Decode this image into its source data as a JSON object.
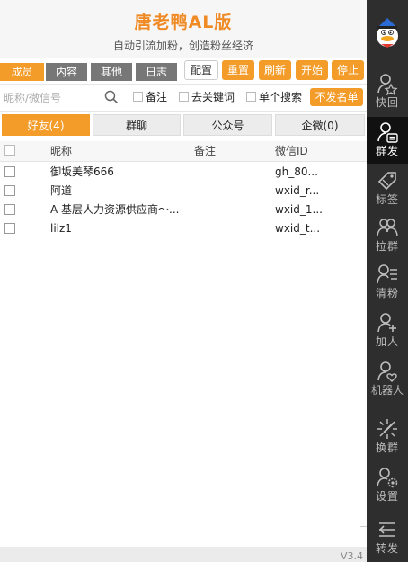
{
  "header": {
    "title": "唐老鸭AL版",
    "subtitle": "自动引流加粉，创造粉丝经济"
  },
  "tabs": [
    {
      "label": "成员"
    },
    {
      "label": "内容"
    },
    {
      "label": "其他"
    },
    {
      "label": "日志"
    }
  ],
  "toolbar": {
    "config": "配置",
    "reset": "重置",
    "refresh": "刷新",
    "start": "开始",
    "stop": "停止"
  },
  "search": {
    "placeholder": "昵称/微信号",
    "note_label": "备注",
    "remove_keyword_label": "去关键词",
    "single_search_label": "单个搜索",
    "no_send_button": "不发名单"
  },
  "categories": [
    {
      "label": "好友(4)"
    },
    {
      "label": "群聊"
    },
    {
      "label": "公众号"
    },
    {
      "label": "企微(0)"
    }
  ],
  "table": {
    "headers": {
      "nickname": "昵称",
      "remark": "备注",
      "wxid": "微信ID"
    },
    "rows": [
      {
        "nickname": "御坂美琴666",
        "remark": "",
        "wxid": "gh_80..."
      },
      {
        "nickname": "阿道",
        "remark": "",
        "wxid": "wxid_r..."
      },
      {
        "nickname": "A 基层人力资源供应商～...",
        "remark": "",
        "wxid": "wxid_1..."
      },
      {
        "nickname": "lilz1",
        "remark": "",
        "wxid": "wxid_t..."
      }
    ]
  },
  "footer": {
    "version": "V3.4"
  },
  "sidebar": {
    "items": [
      {
        "label": "快回",
        "icon": "quick-reply-icon"
      },
      {
        "label": "群发",
        "icon": "mass-send-icon"
      },
      {
        "label": "标签",
        "icon": "tag-icon"
      },
      {
        "label": "拉群",
        "icon": "pull-group-icon"
      },
      {
        "label": "清粉",
        "icon": "clean-fans-icon"
      },
      {
        "label": "加人",
        "icon": "add-person-icon"
      },
      {
        "label": "机器人",
        "icon": "robot-icon"
      },
      {
        "label": "换群",
        "icon": "switch-group-icon"
      },
      {
        "label": "设置",
        "icon": "settings-icon"
      },
      {
        "label": "转发",
        "icon": "forward-icon"
      }
    ]
  },
  "colors": {
    "accent": "#f39c2a",
    "sidebar_bg": "#2e2e2e",
    "title": "#f08a24"
  }
}
